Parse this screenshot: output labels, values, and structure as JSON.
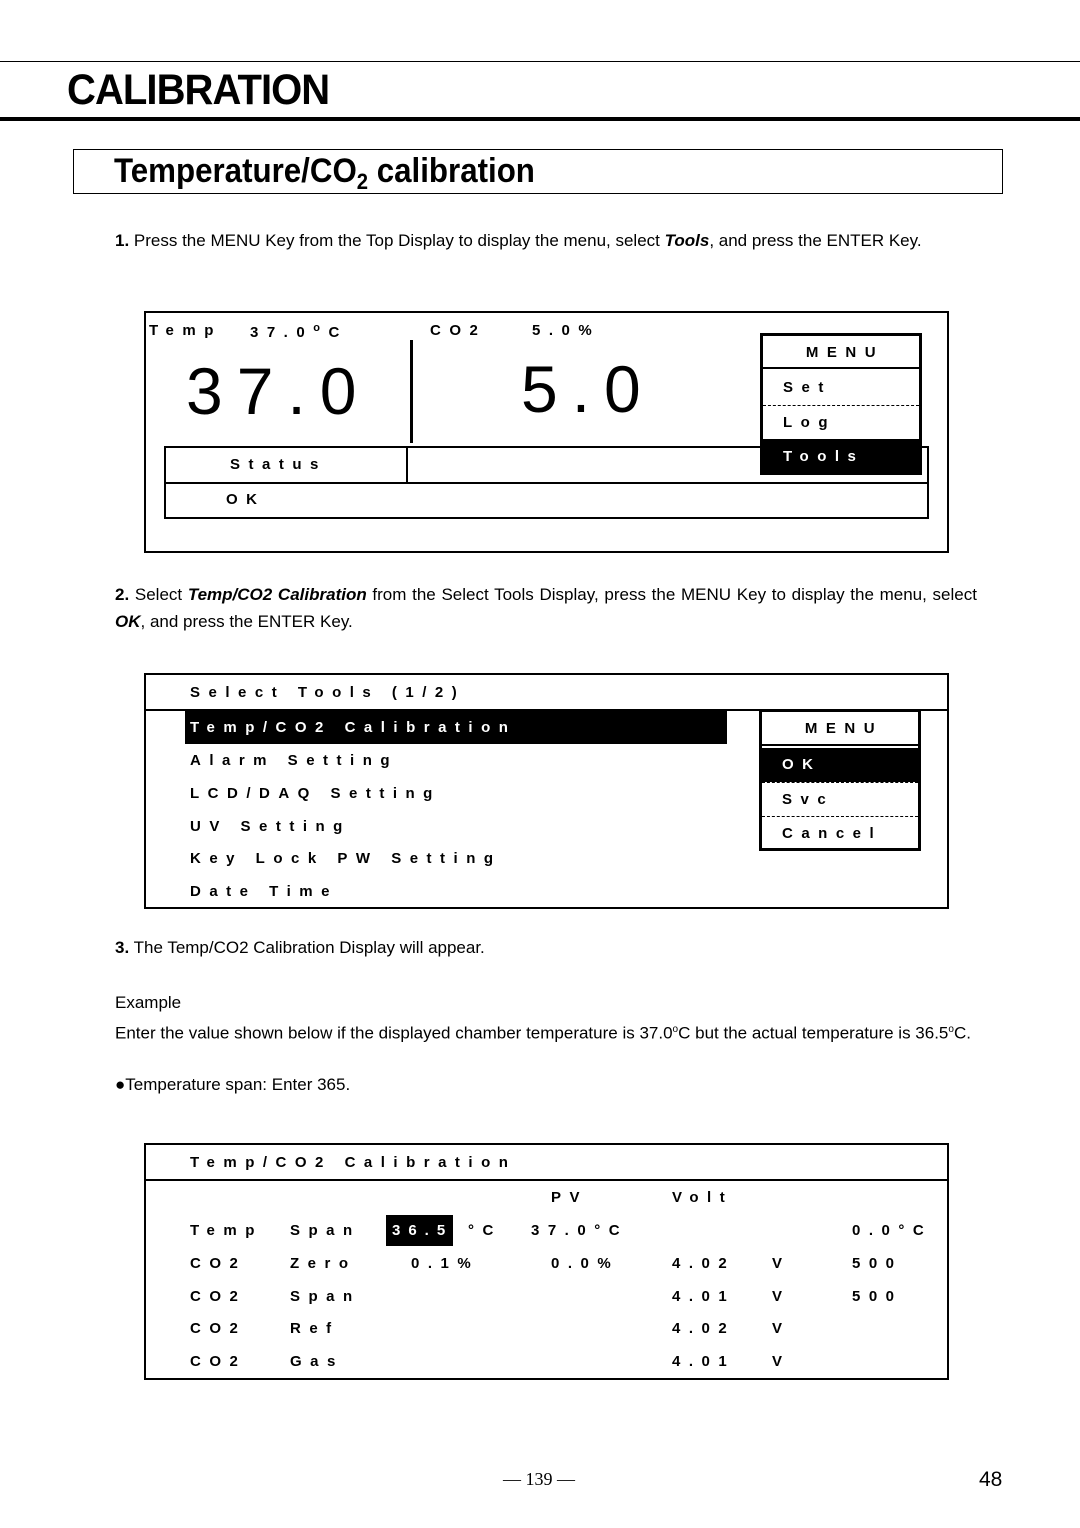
{
  "chapter": {
    "title": "CALIBRATION"
  },
  "section": {
    "title_prefix": "Temperature/CO",
    "title_sub": "2",
    "title_suffix": " calibration"
  },
  "steps": [
    {
      "number": "1.",
      "text_a": " Press the MENU Key from the Top Display to display the menu, select ",
      "emph_a": "Tools",
      "text_b": ", and press the ENTER Key."
    },
    {
      "number": "2.",
      "text_a": " Select ",
      "emph_a": "Temp/CO2 Calibration",
      "text_b": " from the Select Tools Display, press the MENU Key to display the menu, select ",
      "emph_b": "OK",
      "text_c": ", and press the ENTER Key."
    },
    {
      "number": "3.",
      "text_a": " The Temp/CO2 Calibration Display will appear."
    }
  ],
  "example": {
    "heading": "Example",
    "line1_a": "Enter the value shown below if the displayed chamber temperature is 37.0",
    "deg": "o",
    "line1_b": "C but the actual temperature is 36.5",
    "line1_c": "C.",
    "bullet": "●Temperature span: Enter 365."
  },
  "top_display": {
    "temp_label": "Temp",
    "temp_value": "37.0",
    "temp_deg": "o",
    "temp_unit": "C",
    "co2_label": "CO2",
    "co2_value": "5.0%",
    "big_temp": "37.0",
    "big_co2": "5.0",
    "status_label": "Status",
    "status_value": "OK",
    "menu": {
      "title": "MENU",
      "items": [
        "Set",
        "Log",
        "Tools"
      ],
      "selected": "Tools"
    }
  },
  "select_tools": {
    "title": "Select Tools (1/2)",
    "items": [
      "Temp/CO2 Calibration",
      "Alarm Setting",
      "LCD/DAQ Setting",
      "UV Setting",
      "Key Lock PW Setting",
      "Date Time"
    ],
    "selected": "Temp/CO2 Calibration",
    "menu": {
      "title": "MENU",
      "items": [
        "OK",
        "Svc",
        "Cancel"
      ],
      "selected": "OK"
    }
  },
  "calibration_display": {
    "title": "Temp/CO2 Calibration",
    "col_pv": "PV",
    "col_volt": "Volt",
    "rows": [
      {
        "name": "Temp",
        "param": "Span",
        "value": "36.5",
        "value_unit": "°C",
        "pv": "37.0°C",
        "volt": "",
        "volt_unit": "",
        "extra": "0.0°C"
      },
      {
        "name": "CO2",
        "param": "Zero",
        "value": "0.1%",
        "value_unit": "",
        "pv": "0.0%",
        "volt": "4.02",
        "volt_unit": "V",
        "extra": "500"
      },
      {
        "name": "CO2",
        "param": "Span",
        "value": "",
        "value_unit": "",
        "pv": "",
        "volt": "4.01",
        "volt_unit": "V",
        "extra": "500"
      },
      {
        "name": "CO2",
        "param": "Ref",
        "value": "",
        "value_unit": "",
        "pv": "",
        "volt": "4.02",
        "volt_unit": "V",
        "extra": ""
      },
      {
        "name": "CO2",
        "param": "Gas",
        "value": "",
        "value_unit": "",
        "pv": "",
        "volt": "4.01",
        "volt_unit": "V",
        "extra": ""
      }
    ]
  },
  "footer": {
    "center": "— 139 —",
    "page": "48"
  }
}
